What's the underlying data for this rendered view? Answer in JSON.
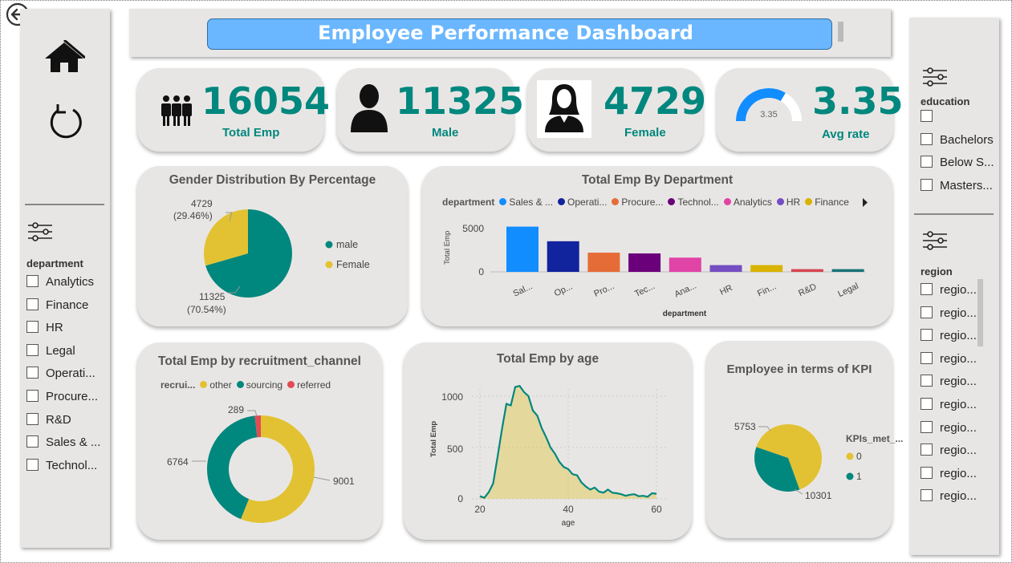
{
  "header": {
    "title": "Employee Performance Dashboard"
  },
  "nav": {
    "back_icon": "back-arrow-icon",
    "home_icon": "home-icon",
    "refresh_icon": "refresh-icon"
  },
  "kpis": [
    {
      "value": "16054",
      "label": "Total Emp",
      "icon": "group-icon"
    },
    {
      "value": "11325",
      "label": "Male",
      "icon": "male-icon"
    },
    {
      "value": "4729",
      "label": "Female",
      "icon": "female-icon"
    },
    {
      "value": "3.35",
      "label": "Avg rate",
      "icon": "gauge-icon",
      "gauge_label": "3.35",
      "gauge_fraction": 0.67
    }
  ],
  "slicers": {
    "department": {
      "title": "department",
      "items": [
        "Analytics",
        "Finance",
        "HR",
        "Legal",
        "Operati...",
        "Procure...",
        "R&D",
        "Sales & ...",
        "Technol..."
      ]
    },
    "education": {
      "title": "education",
      "items": [
        "",
        "Bachelors",
        "Below S...",
        "Masters..."
      ]
    },
    "region": {
      "title": "region",
      "items": [
        "regio...",
        "regio...",
        "regio...",
        "regio...",
        "regio...",
        "regio...",
        "regio...",
        "regio...",
        "regio...",
        "regio..."
      ]
    }
  },
  "colors": {
    "teal": "#00877e",
    "gold": "#e2c232",
    "red": "#e04b55",
    "accent": "#6ab7ff",
    "card": "#e8e6e4"
  },
  "gender_chart": {
    "title": "Gender Distribution By Percentage",
    "female_label": "4729",
    "female_pct": "(29.46%)",
    "male_label": "11325",
    "male_pct": "(70.54%)",
    "legend_male": "male",
    "legend_female": "Female"
  },
  "dept_chart": {
    "title": "Total Emp By Department",
    "legend_title": "department",
    "legend_items": [
      "Sales & ...",
      "Operati...",
      "Procure...",
      "Technol...",
      "Analytics",
      "HR",
      "Finance"
    ],
    "ylabel": "Total Emp",
    "xlabel": "department",
    "y_ticks": [
      "5000",
      "0"
    ]
  },
  "recruit_chart": {
    "title": "Total Emp by recruitment_channel",
    "legend_title": "recrui...",
    "legend_items": [
      "other",
      "sourcing",
      "referred"
    ],
    "label_other": "9001",
    "label_sourcing": "6764",
    "label_referred": "289"
  },
  "age_chart": {
    "title": "Total Emp by age",
    "ylabel": "Total Emp",
    "xlabel": "age",
    "y_ticks": [
      "1000",
      "500",
      "0"
    ],
    "x_ticks": [
      "20",
      "40",
      "60"
    ]
  },
  "kpi_chart": {
    "title": "Employee in terms of KPI",
    "legend_title": "KPIs_met_...",
    "legend_items": [
      "0",
      "1"
    ],
    "label_0": "10301",
    "label_1": "5753"
  },
  "chart_data": [
    {
      "type": "pie",
      "title": "Gender Distribution By Percentage",
      "categories": [
        "male",
        "Female"
      ],
      "values": [
        11325,
        4729
      ],
      "percent": [
        70.54,
        29.46
      ],
      "legend": "right"
    },
    {
      "type": "bar",
      "title": "Total Emp By Department",
      "categories": [
        "Sal...",
        "Op...",
        "Pro...",
        "Tec...",
        "Ana...",
        "HR",
        "Fin...",
        "R&D",
        "Legal"
      ],
      "values": [
        4950,
        3350,
        2100,
        2020,
        1560,
        740,
        740,
        300,
        300
      ],
      "colors": [
        "#118dff",
        "#12239e",
        "#e66c37",
        "#6b007b",
        "#e044a7",
        "#744ec2",
        "#d9b300",
        "#d64550",
        "#197278"
      ],
      "xlabel": "department",
      "ylabel": "Total Emp",
      "ylim": [
        0,
        5700
      ],
      "legend": "top"
    },
    {
      "type": "pie",
      "title": "Total Emp by recruitment_channel",
      "categories": [
        "other",
        "sourcing",
        "referred"
      ],
      "values": [
        9001,
        6764,
        289
      ],
      "donut": true,
      "legend": "top"
    },
    {
      "type": "area",
      "title": "Total Emp by age",
      "xlabel": "age",
      "ylabel": "Total Emp",
      "x": [
        20,
        21,
        22,
        23,
        24,
        25,
        26,
        27,
        28,
        29,
        30,
        31,
        32,
        33,
        34,
        35,
        36,
        37,
        38,
        39,
        40,
        41,
        42,
        43,
        44,
        45,
        46,
        47,
        48,
        49,
        50,
        51,
        52,
        53,
        54,
        55,
        56,
        57,
        58,
        59,
        60
      ],
      "values": [
        26,
        10,
        65,
        150,
        410,
        680,
        925,
        910,
        1090,
        1100,
        1040,
        1000,
        860,
        810,
        690,
        600,
        500,
        440,
        360,
        310,
        290,
        240,
        230,
        160,
        120,
        90,
        110,
        70,
        60,
        90,
        60,
        55,
        45,
        30,
        40,
        45,
        25,
        30,
        20,
        55,
        50
      ],
      "xlim": [
        19,
        61
      ],
      "ylim": [
        0,
        1150
      ]
    },
    {
      "type": "pie",
      "title": "Employee in terms of KPI",
      "categories": [
        "0",
        "1"
      ],
      "values": [
        10301,
        5753
      ],
      "legend": "right"
    }
  ]
}
